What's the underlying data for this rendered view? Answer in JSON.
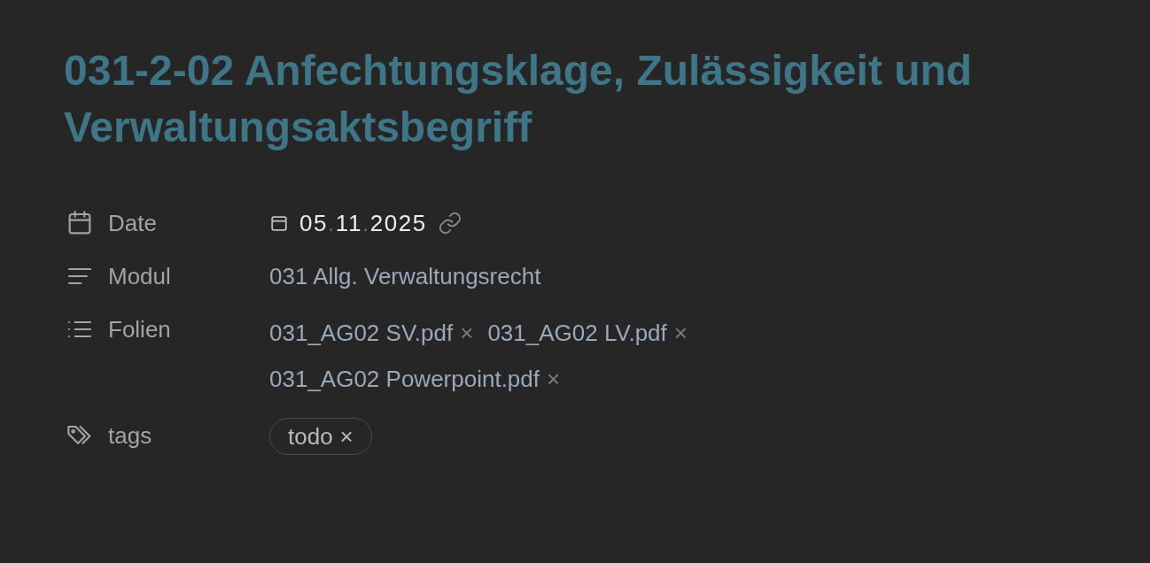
{
  "title": "031-2-02 Anfechtungsklage, Zulässigkeit und Verwaltungsaktsbegriff",
  "properties": [
    {
      "kind": "date",
      "label": "Date",
      "date_parts": [
        "05",
        "11",
        "2025"
      ],
      "separator": "."
    },
    {
      "kind": "text",
      "label": "Modul",
      "value": "031 Allg. Verwaltungsrecht"
    },
    {
      "kind": "list",
      "label": "Folien",
      "items": [
        "031_AG02 SV.pdf",
        "031_AG02 LV.pdf",
        "031_AG02 Powerpoint.pdf"
      ],
      "remove": "×"
    },
    {
      "kind": "tags",
      "label": "tags",
      "items": [
        "todo"
      ],
      "remove": "×"
    }
  ]
}
